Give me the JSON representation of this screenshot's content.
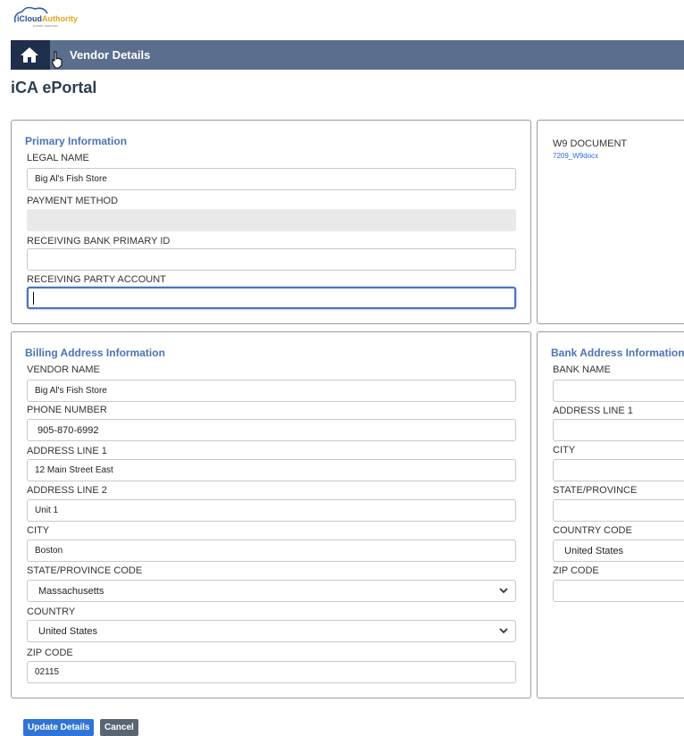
{
  "brand": {
    "logo_text_1": "iCloud",
    "logo_text_2": "Authority",
    "logo_tagline": "EXPERT SERVICES"
  },
  "nav": {
    "title": "Vendor Details"
  },
  "portal_title": "iCA ePortal",
  "primary": {
    "title": "Primary Information",
    "legal_name_label": "LEGAL NAME",
    "legal_name_value": "Big Al's Fish Store",
    "payment_method_label": "PAYMENT METHOD",
    "payment_method_value": "",
    "bank_primary_id_label": "RECEIVING BANK PRIMARY ID",
    "bank_primary_id_value": "",
    "party_account_label": "RECEIVING PARTY ACCOUNT",
    "party_account_value": ""
  },
  "w9": {
    "label": "W9 DOCUMENT",
    "file": "7209_W9docx"
  },
  "billing": {
    "title": "Billing Address Information",
    "vendor_name_label": "VENDOR NAME",
    "vendor_name_value": "Big Al's Fish Store",
    "phone_label": "PHONE NUMBER",
    "phone_value": "905-870-6992",
    "address1_label": "ADDRESS LINE 1",
    "address1_value": "12 Main Street East",
    "address2_label": "ADDRESS LINE 2",
    "address2_value": "Unit 1",
    "city_label": "CITY",
    "city_value": "Boston",
    "state_label": "STATE/PROVINCE CODE",
    "state_value": "Massachusetts",
    "country_label": "COUNTRY",
    "country_value": "United States",
    "zip_label": "ZIP CODE",
    "zip_value": "02115"
  },
  "bank": {
    "title": "Bank Address Information",
    "bank_name_label": "BANK NAME",
    "address1_label": "ADDRESS LINE 1",
    "city_label": "CITY",
    "state_label": "STATE/PROVINCE",
    "country_code_label": "COUNTRY CODE",
    "country_code_value": "United States",
    "zip_label": "ZIP CODE"
  },
  "actions": {
    "update_label": "Update Details",
    "cancel_label": "Cancel"
  },
  "colors": {
    "accent": "#4a73b8",
    "navbar": "#5b6e8e",
    "home_box": "#1f2e4a",
    "primary_button": "#2f74d6"
  }
}
